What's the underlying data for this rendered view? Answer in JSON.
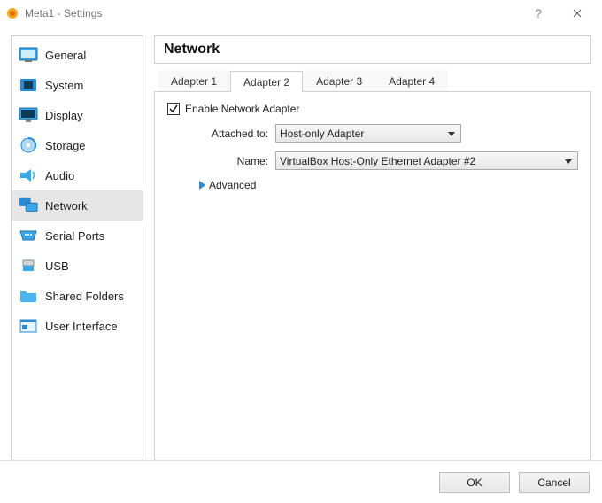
{
  "window": {
    "title": "Meta1 - Settings"
  },
  "sidebar": {
    "items": [
      {
        "label": "General"
      },
      {
        "label": "System"
      },
      {
        "label": "Display"
      },
      {
        "label": "Storage"
      },
      {
        "label": "Audio"
      },
      {
        "label": "Network"
      },
      {
        "label": "Serial Ports"
      },
      {
        "label": "USB"
      },
      {
        "label": "Shared Folders"
      },
      {
        "label": "User Interface"
      }
    ],
    "selected_index": 5
  },
  "main": {
    "heading": "Network",
    "tabs": [
      {
        "label": "Adapter 1"
      },
      {
        "label": "Adapter 2"
      },
      {
        "label": "Adapter 3"
      },
      {
        "label": "Adapter 4"
      }
    ],
    "selected_tab": 1,
    "enable_label": "Enable Network Adapter",
    "enable_checked": true,
    "attached_label": "Attached to:",
    "attached_value": "Host-only Adapter",
    "name_label": "Name:",
    "name_value": "VirtualBox Host-Only Ethernet Adapter #2",
    "advanced_label": "Advanced"
  },
  "footer": {
    "ok": "OK",
    "cancel": "Cancel"
  }
}
